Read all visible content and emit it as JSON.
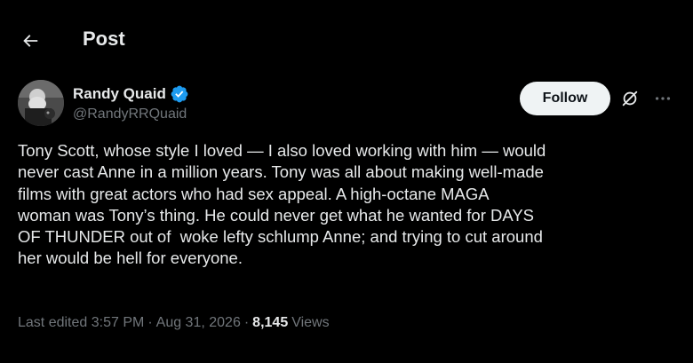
{
  "header": {
    "title": "Post",
    "back_icon": "arrow-left-icon"
  },
  "author": {
    "display_name": "Randy Quaid",
    "handle": "@RandyRRQuaid",
    "verified_icon": "verified-badge-icon",
    "verified_color": "#1d9bf0"
  },
  "actions": {
    "follow_label": "Follow",
    "grok_icon": "grok-icon",
    "more_icon": "more-dots-icon"
  },
  "tweet": {
    "text": "Tony Scott, whose style I loved — I also loved working with him — would\nnever cast Anne in a million years. Tony was all about making well-made\nfilms with great actors who had sex appeal. A high-octane MAGA\nwoman was Tony’s thing. He could never get what he wanted for DAYS\nOF THUNDER out of  woke lefty schlump Anne; and trying to cut around\nher would be hell for everyone."
  },
  "meta": {
    "edited": "Last edited 3:57 PM",
    "separator": "·",
    "date": "Aug 31, 2026",
    "views_count": "8,145",
    "views_label": "Views"
  },
  "colors": {
    "background": "#000000",
    "primary_text": "#e7e9ea",
    "secondary_text": "#71767b",
    "follow_bg": "#eff3f4"
  }
}
